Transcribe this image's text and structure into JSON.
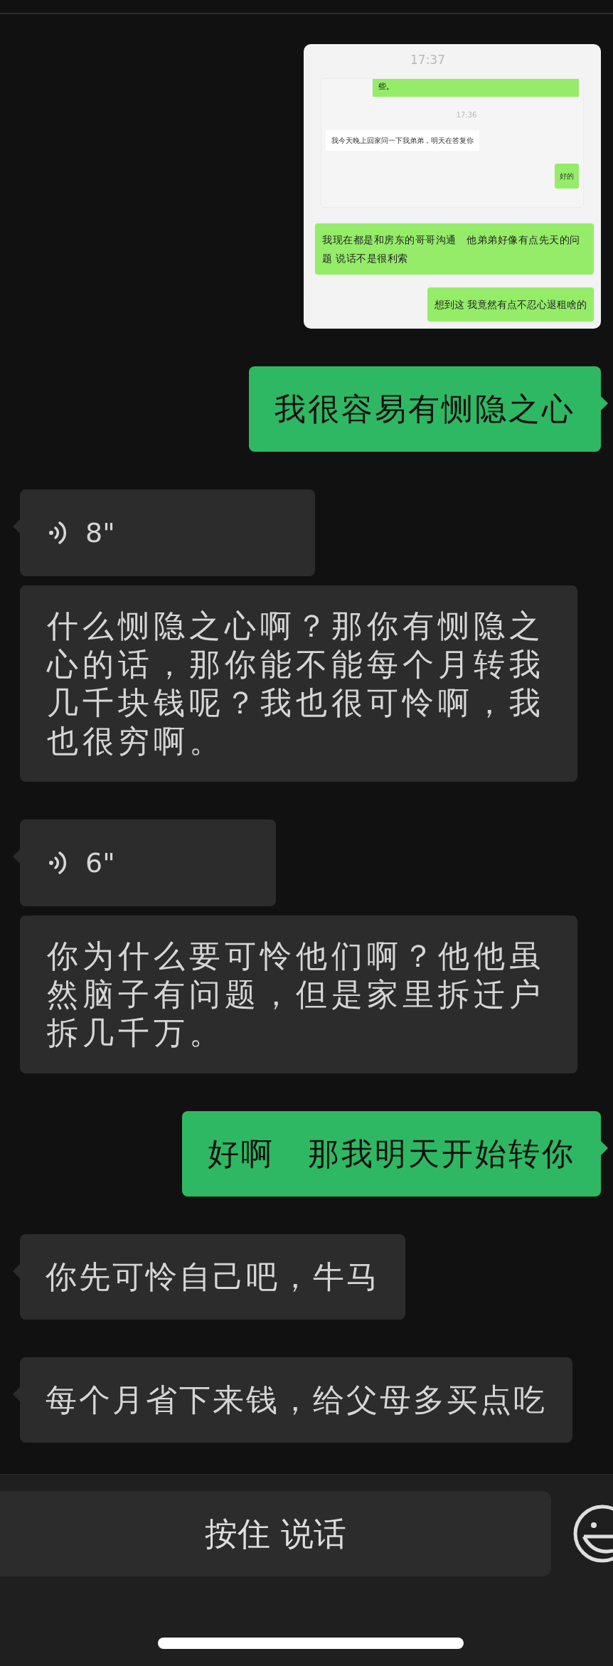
{
  "messages": [
    {
      "kind": "image",
      "outgoing": true,
      "image": {
        "time": "17:37",
        "quoted": {
          "fragment": "些。",
          "time": "17:36",
          "messages": [
            {
              "outgoing": false,
              "text": "我今天晚上回家问一下我弟弟，明天在答复你"
            },
            {
              "outgoing": true,
              "text": "好的"
            }
          ]
        },
        "messages": [
          {
            "text": "我现在都是和房东的哥哥沟通　他弟弟好像有点先天的问题  说话不是很利索"
          },
          {
            "text": "想到这  我竟然有点不忍心退租啥的"
          }
        ]
      }
    },
    {
      "kind": "text",
      "outgoing": true,
      "text": "我很容易有恻隐之心"
    },
    {
      "kind": "voice",
      "outgoing": false,
      "duration": "8\"",
      "transcript": "什么恻隐之心啊？那你有恻隐之心的话，那你能不能每个月转我几千块钱呢？我也很可怜啊，我也很穷啊。"
    },
    {
      "kind": "voice",
      "outgoing": false,
      "duration": "6\"",
      "transcript": "你为什么要可怜他们啊？他他虽然脑子有问题，但是家里拆迁户拆几千万。"
    },
    {
      "kind": "text",
      "outgoing": true,
      "text": "好啊　那我明天开始转你"
    },
    {
      "kind": "text",
      "outgoing": false,
      "text": "你先可怜自己吧，牛马"
    },
    {
      "kind": "text",
      "outgoing": false,
      "text": "每个月省下来钱，给父母多买点吃"
    }
  ],
  "input_bar": {
    "hold_to_talk": "按住 说话"
  }
}
